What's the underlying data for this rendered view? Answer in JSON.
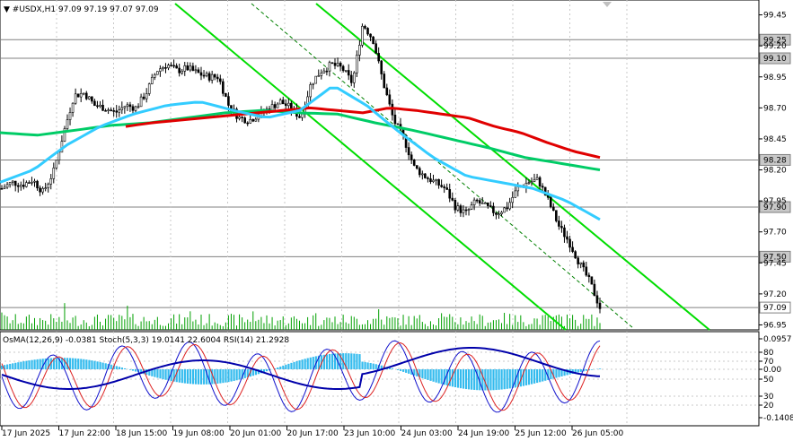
{
  "header": {
    "symbol": "▼ #USDX,H1  97.09 97.19 97.07 97.09"
  },
  "indicator": {
    "label": "OsMA(12,26,9) -0.0381  Stoch(5,3,3) 19.0141 22.6004  RSI(14) 21.2928"
  },
  "chart_data": {
    "type": "candlestick",
    "symbol": "#USDX",
    "timeframe": "H1",
    "last": {
      "open": 97.09,
      "high": 97.19,
      "low": 97.07,
      "close": 97.09
    },
    "price_axis": [
      "99.45",
      "99.20",
      "98.95",
      "98.70",
      "98.45",
      "98.20",
      "97.95",
      "97.70",
      "97.45",
      "97.20",
      "96.95"
    ],
    "price_ylim": [
      96.91,
      99.57
    ],
    "levels": [
      {
        "value": 99.25,
        "label": "99.25"
      },
      {
        "value": 99.1,
        "label": "99.10"
      },
      {
        "value": 98.28,
        "label": "98.28"
      },
      {
        "value": 97.9,
        "label": "97.90"
      },
      {
        "value": 97.5,
        "label": "97.50"
      },
      {
        "value": 97.09,
        "label": "97.09"
      }
    ],
    "time_axis": [
      "17 Jun 2025",
      "17 Jun 22:00",
      "18 Jun 15:00",
      "19 Jun 08:00",
      "20 Jun 01:00",
      "20 Jun 17:00",
      "23 Jun 10:00",
      "24 Jun 03:00",
      "24 Jun 19:00",
      "25 Jun 12:00",
      "26 Jun 05:00"
    ],
    "close_series": [
      98.05,
      98.1,
      98.08,
      98.12,
      98.02,
      98.18,
      98.5,
      98.8,
      98.82,
      98.72,
      98.7,
      98.66,
      98.72,
      98.7,
      98.82,
      99.0,
      99.05,
      99.0,
      99.02,
      98.98,
      98.95,
      98.95,
      98.72,
      98.62,
      98.6,
      98.65,
      98.7,
      98.75,
      98.7,
      98.62,
      98.9,
      99.0,
      99.05,
      99.02,
      98.9,
      99.38,
      99.25,
      98.9,
      98.6,
      98.45,
      98.22,
      98.15,
      98.1,
      98.05,
      97.9,
      97.85,
      97.95,
      97.9,
      97.85,
      97.9,
      98.05,
      98.1,
      98.12,
      97.95,
      97.75,
      97.62,
      97.45,
      97.3,
      97.09
    ],
    "ma_red": [
      98.55,
      98.58,
      98.6,
      98.62,
      98.64,
      98.66,
      98.68,
      98.7,
      98.68,
      98.66,
      98.7,
      98.68,
      98.65,
      98.62,
      98.55,
      98.5,
      98.42,
      98.35,
      98.3
    ],
    "ma_green": [
      98.5,
      98.48,
      98.52,
      98.56,
      98.58,
      98.62,
      98.66,
      98.68,
      98.66,
      98.65,
      98.58,
      98.52,
      98.45,
      98.38,
      98.3,
      98.25,
      98.2
    ],
    "ma_cyan": [
      98.1,
      98.2,
      98.4,
      98.55,
      98.65,
      98.72,
      98.75,
      98.68,
      98.62,
      98.68,
      98.88,
      98.72,
      98.5,
      98.3,
      98.15,
      98.1,
      98.05,
      97.95,
      97.8
    ],
    "indicator_axis": [
      "0.0957",
      "80",
      "70",
      "0.00",
      "50",
      "30",
      "20",
      "-0.1408"
    ]
  }
}
